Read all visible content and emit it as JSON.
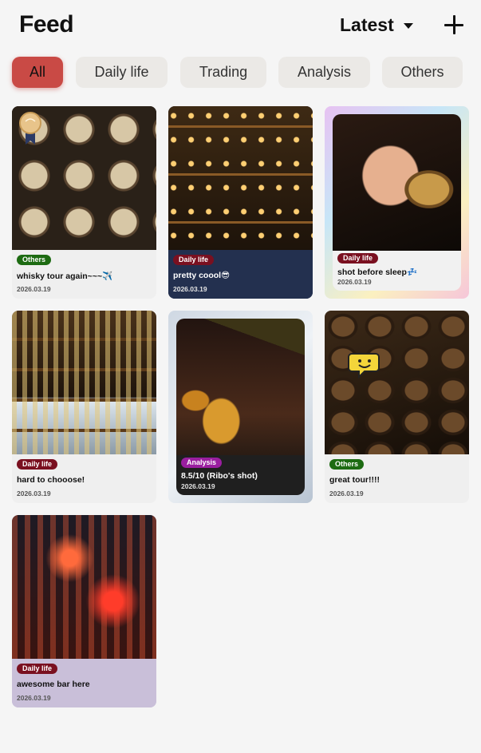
{
  "header": {
    "title": "Feed",
    "sort_label": "Latest"
  },
  "filters": [
    "All",
    "Daily life",
    "Trading",
    "Analysis",
    "Others"
  ],
  "active_filter": "All",
  "colors": {
    "accent": "#c94a45",
    "others_badge": "#1d6b12",
    "daily_life_badge": "#7a1020",
    "analysis_badge": "#9a1ea0"
  },
  "posts": [
    {
      "category": "Others",
      "caption": "whisky tour again~~~✈️",
      "date": "2026.03.19",
      "image_icon": "barrels-photo"
    },
    {
      "category": "Daily life",
      "caption": "pretty coool😎",
      "date": "2026.03.19",
      "image_icon": "bar-shelves-photo"
    },
    {
      "category": "Daily life",
      "caption": "shot before sleep💤",
      "date": "2026.03.19",
      "image_icon": "hand-glass-photo"
    },
    {
      "category": "Daily life",
      "caption": "hard to chooose!",
      "date": "2026.03.19",
      "image_icon": "bottle-shelves-photo"
    },
    {
      "category": "Analysis",
      "caption": "8.5/10 (Ribo's shot)",
      "date": "2026.03.19",
      "image_icon": "pouring-photo"
    },
    {
      "category": "Others",
      "caption": "great tour!!!!",
      "date": "2026.03.19",
      "image_icon": "cellar-photo"
    },
    {
      "category": "Daily life",
      "caption": "awesome bar here",
      "date": "2026.03.19",
      "image_icon": "neon-bottles-photo"
    }
  ]
}
